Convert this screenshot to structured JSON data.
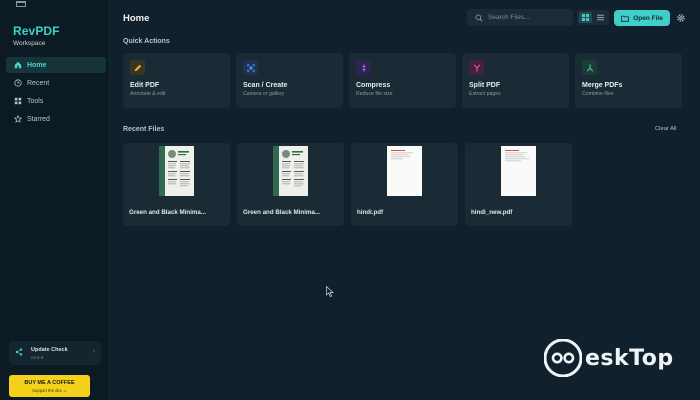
{
  "brand": {
    "title": "RevPDF",
    "subtitle": "Workspace"
  },
  "sidebar": {
    "items": [
      {
        "label": "Home",
        "icon": "home-icon",
        "active": true
      },
      {
        "label": "Recent",
        "icon": "clock-icon",
        "active": false
      },
      {
        "label": "Tools",
        "icon": "grid-icon",
        "active": false
      },
      {
        "label": "Starred",
        "icon": "star-icon",
        "active": false
      }
    ],
    "update": {
      "title": "Update Check",
      "version": "v4.5.0"
    },
    "coffee": {
      "title": "BUY ME A COFFEE",
      "subtitle": "Support the dev ☕"
    }
  },
  "header": {
    "title": "Home",
    "search_placeholder": "Search Files...",
    "open_file_label": "Open File"
  },
  "quick_actions": {
    "label": "Quick Actions",
    "items": [
      {
        "title": "Edit PDF",
        "subtitle": "Annotate & edit",
        "icon": "edit-icon",
        "color": "#e2b23a",
        "bg": "#3a3520"
      },
      {
        "title": "Scan / Create",
        "subtitle": "Camera or gallery",
        "icon": "scan-icon",
        "color": "#4a8fe6",
        "bg": "#1d3350"
      },
      {
        "title": "Compress",
        "subtitle": "Reduce file size",
        "icon": "compress-icon",
        "color": "#a070e6",
        "bg": "#2e2450"
      },
      {
        "title": "Split PDF",
        "subtitle": "Extract pages",
        "icon": "split-icon",
        "color": "#e05ab8",
        "bg": "#45213f"
      },
      {
        "title": "Merge PDFs",
        "subtitle": "Combine files",
        "icon": "merge-icon",
        "color": "#3fcfa0",
        "bg": "#1b3d38"
      }
    ]
  },
  "recent": {
    "label": "Recent Files",
    "clear_label": "Clear All",
    "files": [
      {
        "name": "Green and Black Minima...",
        "thumb": "resume"
      },
      {
        "name": "Green and Black Minima...",
        "thumb": "resume"
      },
      {
        "name": "hindi.pdf",
        "thumb": "doc"
      },
      {
        "name": "hindi_new.pdf",
        "thumb": "doc"
      }
    ]
  },
  "watermark": {
    "text": "eskTop"
  },
  "colors": {
    "accent": "#3fcfc8",
    "background": "#10202c",
    "card": "#1a2b36",
    "coffee": "#f4d21b"
  }
}
